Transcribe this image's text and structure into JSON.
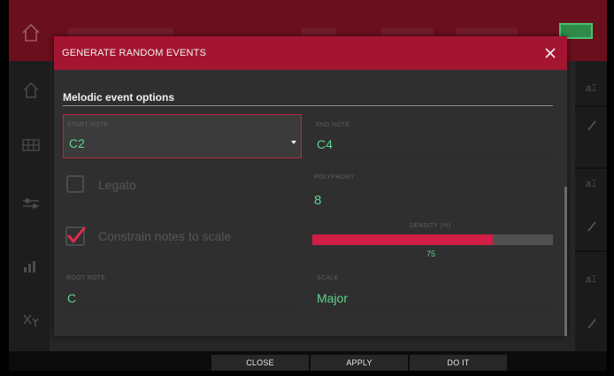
{
  "app": {
    "right_icons": [
      "text-cursor-icon",
      "pencil-icon",
      "text-cursor-icon",
      "pencil-icon",
      "text-cursor-icon",
      "pencil-icon"
    ],
    "left_icons": [
      "home-icon",
      "grid-icon",
      "sliders-icon",
      "bars-icon",
      "xy-icon"
    ]
  },
  "dialog": {
    "title": "GENERATE RANDOM EVENTS",
    "section_title": "Melodic event options",
    "start_note": {
      "label": "START NOTE",
      "value": "C2"
    },
    "end_note": {
      "label": "END NOTE",
      "value": "C4"
    },
    "legato": {
      "label": "Legato",
      "checked": false
    },
    "constrain": {
      "label": "Constrain notes to scale",
      "checked": true
    },
    "polyphony": {
      "label": "POLYPHONY",
      "value": "8"
    },
    "density": {
      "label": "DENSITY (%)",
      "value": "75",
      "fraction": 0.75
    },
    "root_note": {
      "label": "ROOT NOTE",
      "value": "C"
    },
    "scale": {
      "label": "SCALE",
      "value": "Major"
    }
  },
  "actions": {
    "close": "CLOSE",
    "apply": "APPLY",
    "do_it": "DO IT"
  },
  "colors": {
    "accent": "#a31530",
    "value_green": "#5fd38e",
    "density_fill": "#d01e46"
  }
}
